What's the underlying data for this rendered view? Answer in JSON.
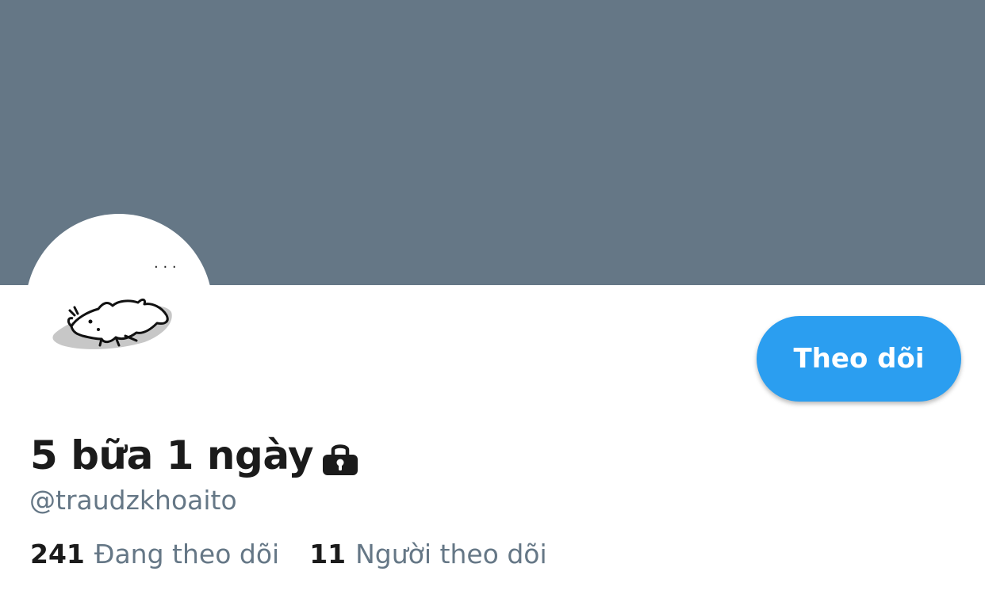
{
  "profile": {
    "display_name": "5 bữa 1 ngày",
    "handle": "@traudzkhoaito",
    "protected": true,
    "avatar_overlay_text": ". . ."
  },
  "actions": {
    "follow_label": "Theo dõi"
  },
  "stats": {
    "following": {
      "count": "241",
      "label": "Đang theo dõi"
    },
    "followers": {
      "count": "11",
      "label": "Người theo dõi"
    }
  },
  "icons": {
    "lock": "lock-icon"
  },
  "colors": {
    "banner": "#657786",
    "accent": "#2b9ef0",
    "text_primary": "#1b1b1b",
    "text_secondary": "#657786"
  }
}
